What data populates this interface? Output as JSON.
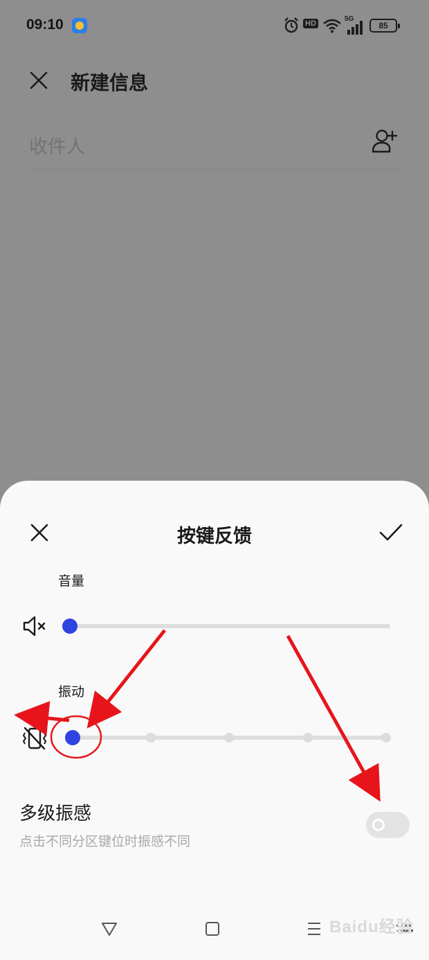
{
  "status_bar": {
    "time": "09:10",
    "hd": "HD",
    "network": "5G",
    "battery": "85"
  },
  "compose": {
    "title": "新建信息",
    "recipient_placeholder": "收件人",
    "icons": {
      "close": "close-icon",
      "add_contact": "add-contact-icon"
    }
  },
  "sheet": {
    "title": "按键反馈",
    "volume": {
      "label": "音量",
      "level": 0
    },
    "vibration": {
      "label": "振动",
      "level": 0,
      "stops": 5
    },
    "multi_level": {
      "title": "多级振感",
      "description": "点击不同分区键位时振感不同",
      "enabled": false
    },
    "icons": {
      "close": "close-icon",
      "confirm": "check-icon",
      "mute": "speaker-mute-icon",
      "vibrate_off": "vibrate-off-icon"
    }
  },
  "nav_bar": {
    "icons": [
      "triangle-back-icon",
      "square-home-icon",
      "menu-lines-icon",
      "keyboard-icon"
    ]
  },
  "watermark": "Baidu经验",
  "colors": {
    "accent": "#2f43e0",
    "annotation": "#e8141b",
    "backdrop": "#8e8e8e",
    "sheet": "#f9f9f9"
  }
}
